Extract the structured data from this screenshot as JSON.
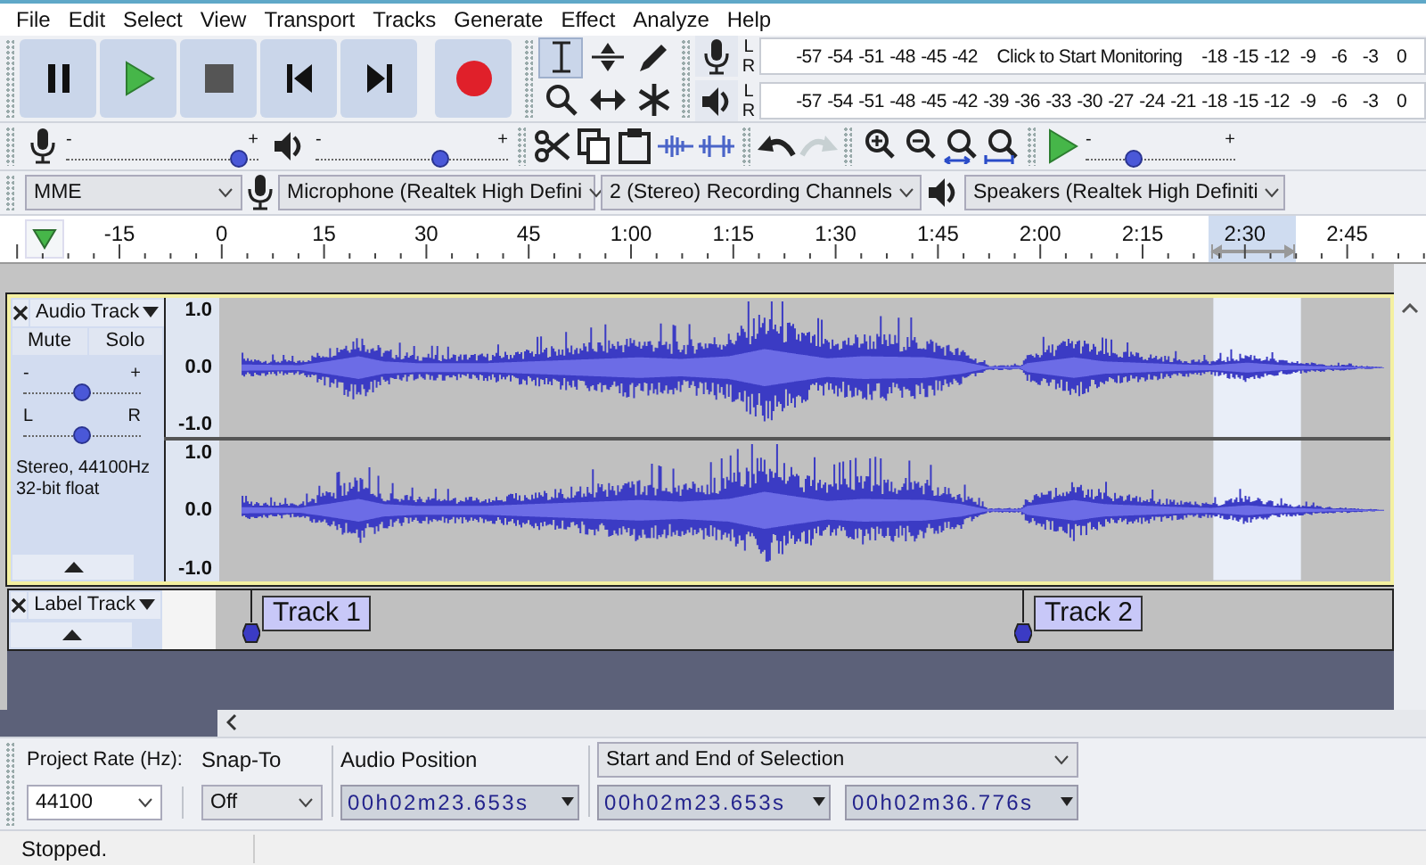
{
  "menu": [
    "File",
    "Edit",
    "Select",
    "View",
    "Transport",
    "Tracks",
    "Generate",
    "Effect",
    "Analyze",
    "Help"
  ],
  "transport": [
    {
      "kind": "pause"
    },
    {
      "kind": "play"
    },
    {
      "kind": "stop"
    },
    {
      "kind": "skip_start"
    },
    {
      "kind": "skip_end"
    },
    {
      "kind": "record"
    }
  ],
  "tools": [
    {
      "kind": "select",
      "selected": true
    },
    {
      "kind": "envelope",
      "selected": false
    },
    {
      "kind": "draw",
      "selected": false
    },
    {
      "kind": "zoom",
      "selected": false
    },
    {
      "kind": "time_shift",
      "selected": false
    },
    {
      "kind": "multi",
      "selected": false
    }
  ],
  "meters": [
    {
      "kind": "record",
      "channels": [
        "L",
        "R"
      ],
      "ticks": [
        "-57",
        "-54",
        "-51",
        "-48",
        "-45",
        "-42"
      ],
      "overlay": "Click to Start Monitoring",
      "ticks_after": [
        "-18",
        "-15",
        "-12",
        "-9",
        "-6",
        "-3",
        "0"
      ]
    },
    {
      "kind": "playback",
      "channels": [
        "L",
        "R"
      ],
      "ticks": [
        "-57",
        "-54",
        "-51",
        "-48",
        "-45",
        "-42",
        "-39",
        "-36",
        "-33",
        "-30",
        "-27",
        "-24",
        "-21",
        "-18",
        "-15",
        "-12",
        "-9",
        "-6",
        "-3",
        "0"
      ]
    }
  ],
  "mixer": [
    {
      "kind": "record",
      "minus": "-",
      "plus": "+",
      "level": 0.9
    },
    {
      "kind": "playback",
      "minus": "-",
      "plus": "+",
      "level": 0.65
    }
  ],
  "edit_tools": [
    {
      "kind": "cut",
      "disabled": false
    },
    {
      "kind": "copy",
      "disabled": false
    },
    {
      "kind": "paste",
      "disabled": false
    },
    {
      "kind": "trim",
      "disabled": false
    },
    {
      "kind": "silence",
      "disabled": false
    }
  ],
  "history": [
    {
      "kind": "undo",
      "disabled": false
    },
    {
      "kind": "redo",
      "disabled": true
    }
  ],
  "zoom_tools": [
    {
      "kind": "zoom_in"
    },
    {
      "kind": "zoom_out"
    },
    {
      "kind": "fit_selection"
    },
    {
      "kind": "fit_project"
    }
  ],
  "play_at_speed": {
    "minus": "-",
    "plus": "+",
    "level": 0.32
  },
  "devices": {
    "host": "MME",
    "input": "Microphone (Realtek High Defini",
    "channels": "2 (Stereo) Recording Channels",
    "output": "Speakers (Realtek High Definiti"
  },
  "ruler": {
    "labels": [
      "-15",
      "0",
      "15",
      "30",
      "45",
      "1:00",
      "1:15",
      "1:30",
      "1:45",
      "2:00",
      "2:15",
      "2:30",
      "2:45"
    ]
  },
  "audio_track": {
    "name": "Audio Track",
    "mute": "Mute",
    "solo": "Solo",
    "gain": {
      "minus": "-",
      "plus": "+",
      "level": 0.5
    },
    "pan": {
      "left": "L",
      "right": "R",
      "level": 0.5
    },
    "info": [
      "Stereo, 44100Hz",
      "32-bit float"
    ],
    "channels": [
      {
        "scale": [
          "1.0",
          "0.0",
          "-1.0"
        ]
      },
      {
        "scale": [
          "1.0",
          "0.0",
          "-1.0"
        ]
      }
    ]
  },
  "label_track": {
    "name": "Label Track",
    "labels": [
      "Track 1",
      "Track 2"
    ]
  },
  "selection_bar": {
    "rate_label": "Project Rate (Hz):",
    "rate": "44100",
    "snap_label": "Snap-To",
    "snap": "Off",
    "position_label": "Audio Position",
    "position": "00h02m23.653s",
    "selection_mode": "Start and End of Selection",
    "selection_start": "00h02m23.653s",
    "selection_end": "00h02m36.776s"
  },
  "status": "Stopped."
}
